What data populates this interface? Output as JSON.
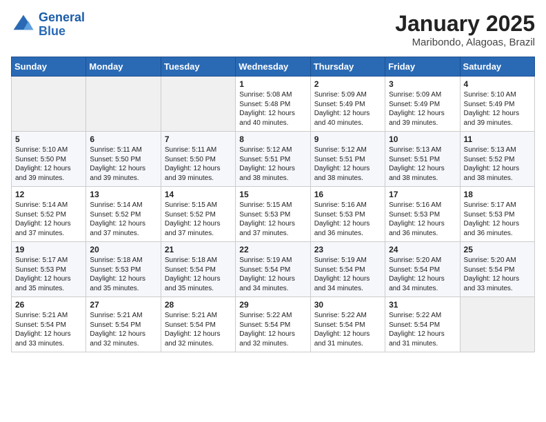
{
  "logo": {
    "line1": "General",
    "line2": "Blue"
  },
  "title": "January 2025",
  "subtitle": "Maribondo, Alagoas, Brazil",
  "days_of_week": [
    "Sunday",
    "Monday",
    "Tuesday",
    "Wednesday",
    "Thursday",
    "Friday",
    "Saturday"
  ],
  "weeks": [
    [
      {
        "day": "",
        "info": ""
      },
      {
        "day": "",
        "info": ""
      },
      {
        "day": "",
        "info": ""
      },
      {
        "day": "1",
        "info": "Sunrise: 5:08 AM\nSunset: 5:48 PM\nDaylight: 12 hours\nand 40 minutes."
      },
      {
        "day": "2",
        "info": "Sunrise: 5:09 AM\nSunset: 5:49 PM\nDaylight: 12 hours\nand 40 minutes."
      },
      {
        "day": "3",
        "info": "Sunrise: 5:09 AM\nSunset: 5:49 PM\nDaylight: 12 hours\nand 39 minutes."
      },
      {
        "day": "4",
        "info": "Sunrise: 5:10 AM\nSunset: 5:49 PM\nDaylight: 12 hours\nand 39 minutes."
      }
    ],
    [
      {
        "day": "5",
        "info": "Sunrise: 5:10 AM\nSunset: 5:50 PM\nDaylight: 12 hours\nand 39 minutes."
      },
      {
        "day": "6",
        "info": "Sunrise: 5:11 AM\nSunset: 5:50 PM\nDaylight: 12 hours\nand 39 minutes."
      },
      {
        "day": "7",
        "info": "Sunrise: 5:11 AM\nSunset: 5:50 PM\nDaylight: 12 hours\nand 39 minutes."
      },
      {
        "day": "8",
        "info": "Sunrise: 5:12 AM\nSunset: 5:51 PM\nDaylight: 12 hours\nand 38 minutes."
      },
      {
        "day": "9",
        "info": "Sunrise: 5:12 AM\nSunset: 5:51 PM\nDaylight: 12 hours\nand 38 minutes."
      },
      {
        "day": "10",
        "info": "Sunrise: 5:13 AM\nSunset: 5:51 PM\nDaylight: 12 hours\nand 38 minutes."
      },
      {
        "day": "11",
        "info": "Sunrise: 5:13 AM\nSunset: 5:52 PM\nDaylight: 12 hours\nand 38 minutes."
      }
    ],
    [
      {
        "day": "12",
        "info": "Sunrise: 5:14 AM\nSunset: 5:52 PM\nDaylight: 12 hours\nand 37 minutes."
      },
      {
        "day": "13",
        "info": "Sunrise: 5:14 AM\nSunset: 5:52 PM\nDaylight: 12 hours\nand 37 minutes."
      },
      {
        "day": "14",
        "info": "Sunrise: 5:15 AM\nSunset: 5:52 PM\nDaylight: 12 hours\nand 37 minutes."
      },
      {
        "day": "15",
        "info": "Sunrise: 5:15 AM\nSunset: 5:53 PM\nDaylight: 12 hours\nand 37 minutes."
      },
      {
        "day": "16",
        "info": "Sunrise: 5:16 AM\nSunset: 5:53 PM\nDaylight: 12 hours\nand 36 minutes."
      },
      {
        "day": "17",
        "info": "Sunrise: 5:16 AM\nSunset: 5:53 PM\nDaylight: 12 hours\nand 36 minutes."
      },
      {
        "day": "18",
        "info": "Sunrise: 5:17 AM\nSunset: 5:53 PM\nDaylight: 12 hours\nand 36 minutes."
      }
    ],
    [
      {
        "day": "19",
        "info": "Sunrise: 5:17 AM\nSunset: 5:53 PM\nDaylight: 12 hours\nand 35 minutes."
      },
      {
        "day": "20",
        "info": "Sunrise: 5:18 AM\nSunset: 5:53 PM\nDaylight: 12 hours\nand 35 minutes."
      },
      {
        "day": "21",
        "info": "Sunrise: 5:18 AM\nSunset: 5:54 PM\nDaylight: 12 hours\nand 35 minutes."
      },
      {
        "day": "22",
        "info": "Sunrise: 5:19 AM\nSunset: 5:54 PM\nDaylight: 12 hours\nand 34 minutes."
      },
      {
        "day": "23",
        "info": "Sunrise: 5:19 AM\nSunset: 5:54 PM\nDaylight: 12 hours\nand 34 minutes."
      },
      {
        "day": "24",
        "info": "Sunrise: 5:20 AM\nSunset: 5:54 PM\nDaylight: 12 hours\nand 34 minutes."
      },
      {
        "day": "25",
        "info": "Sunrise: 5:20 AM\nSunset: 5:54 PM\nDaylight: 12 hours\nand 33 minutes."
      }
    ],
    [
      {
        "day": "26",
        "info": "Sunrise: 5:21 AM\nSunset: 5:54 PM\nDaylight: 12 hours\nand 33 minutes."
      },
      {
        "day": "27",
        "info": "Sunrise: 5:21 AM\nSunset: 5:54 PM\nDaylight: 12 hours\nand 32 minutes."
      },
      {
        "day": "28",
        "info": "Sunrise: 5:21 AM\nSunset: 5:54 PM\nDaylight: 12 hours\nand 32 minutes."
      },
      {
        "day": "29",
        "info": "Sunrise: 5:22 AM\nSunset: 5:54 PM\nDaylight: 12 hours\nand 32 minutes."
      },
      {
        "day": "30",
        "info": "Sunrise: 5:22 AM\nSunset: 5:54 PM\nDaylight: 12 hours\nand 31 minutes."
      },
      {
        "day": "31",
        "info": "Sunrise: 5:22 AM\nSunset: 5:54 PM\nDaylight: 12 hours\nand 31 minutes."
      },
      {
        "day": "",
        "info": ""
      }
    ]
  ]
}
